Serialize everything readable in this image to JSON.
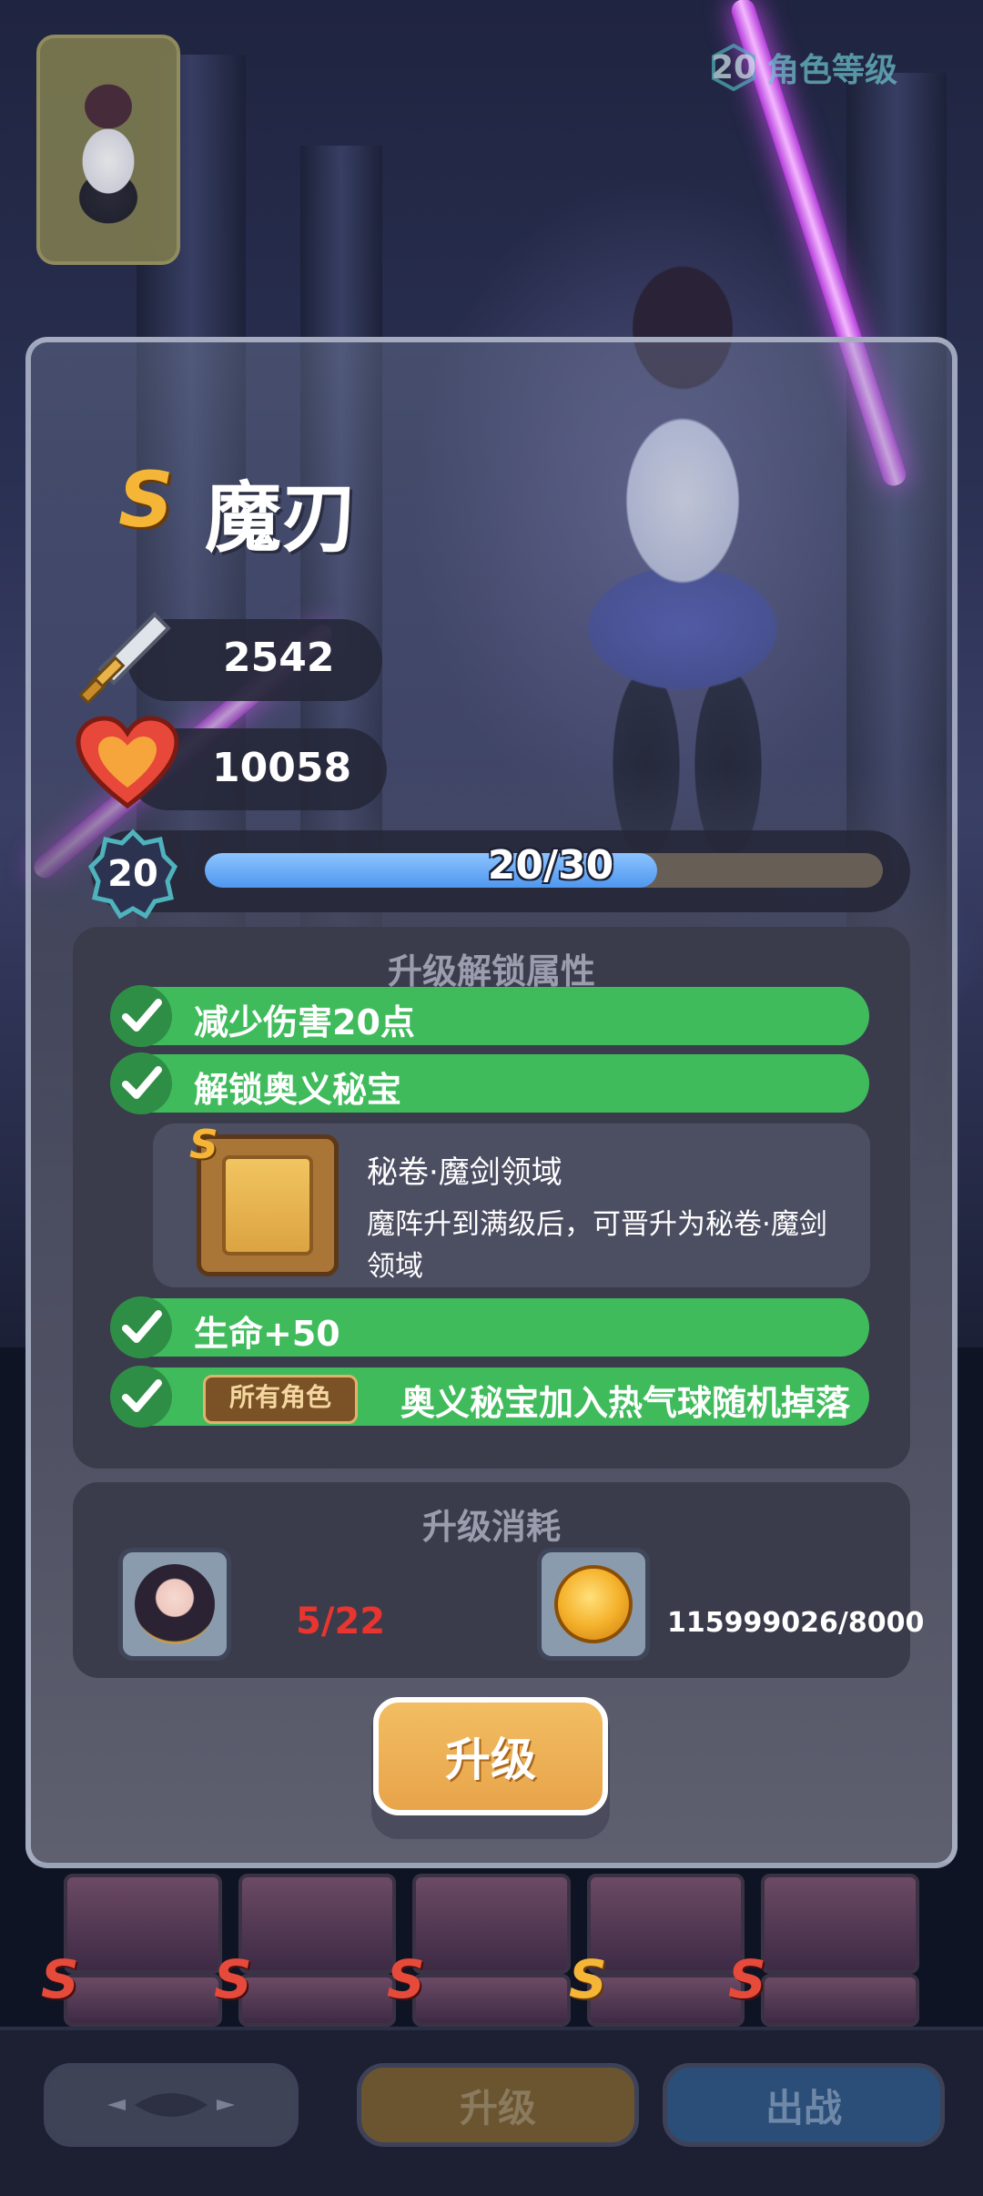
{
  "header": {
    "level_value": "20",
    "level_label": "角色等级"
  },
  "hero": {
    "rank": "S",
    "name": "魔刃",
    "attack": "2542",
    "hp": "10058",
    "level": "20",
    "xp_text": "20/30",
    "xp_progress": 0.667
  },
  "unlock": {
    "title": "升级解锁属性",
    "rows": [
      {
        "label": "减少伤害20点"
      },
      {
        "label": "解锁奥义秘宝"
      },
      {
        "label": "生命+50"
      },
      {
        "tag": "所有角色",
        "label": "奥义秘宝加入热气球随机掉落"
      }
    ],
    "treasure": {
      "rank": "S",
      "title": "秘卷·魔剑领域",
      "desc": "魔阵升到满级后，可晋升为秘卷·魔剑领域"
    }
  },
  "cost": {
    "title": "升级消耗",
    "fragments": "5/22",
    "gold": "115999026/8000"
  },
  "buttons": {
    "upgrade": "升级"
  },
  "roster": {
    "ranks": [
      "S",
      "S",
      "S",
      "S",
      "S"
    ]
  },
  "bottom_nav": {
    "upgrade": "升级",
    "battle": "出战"
  },
  "colors": {
    "accent_green": "#3fbb5c",
    "upgrade_orange": "#e8a44a",
    "fragment_red": "#e8352f",
    "xp_blue": "#4f97ef"
  }
}
